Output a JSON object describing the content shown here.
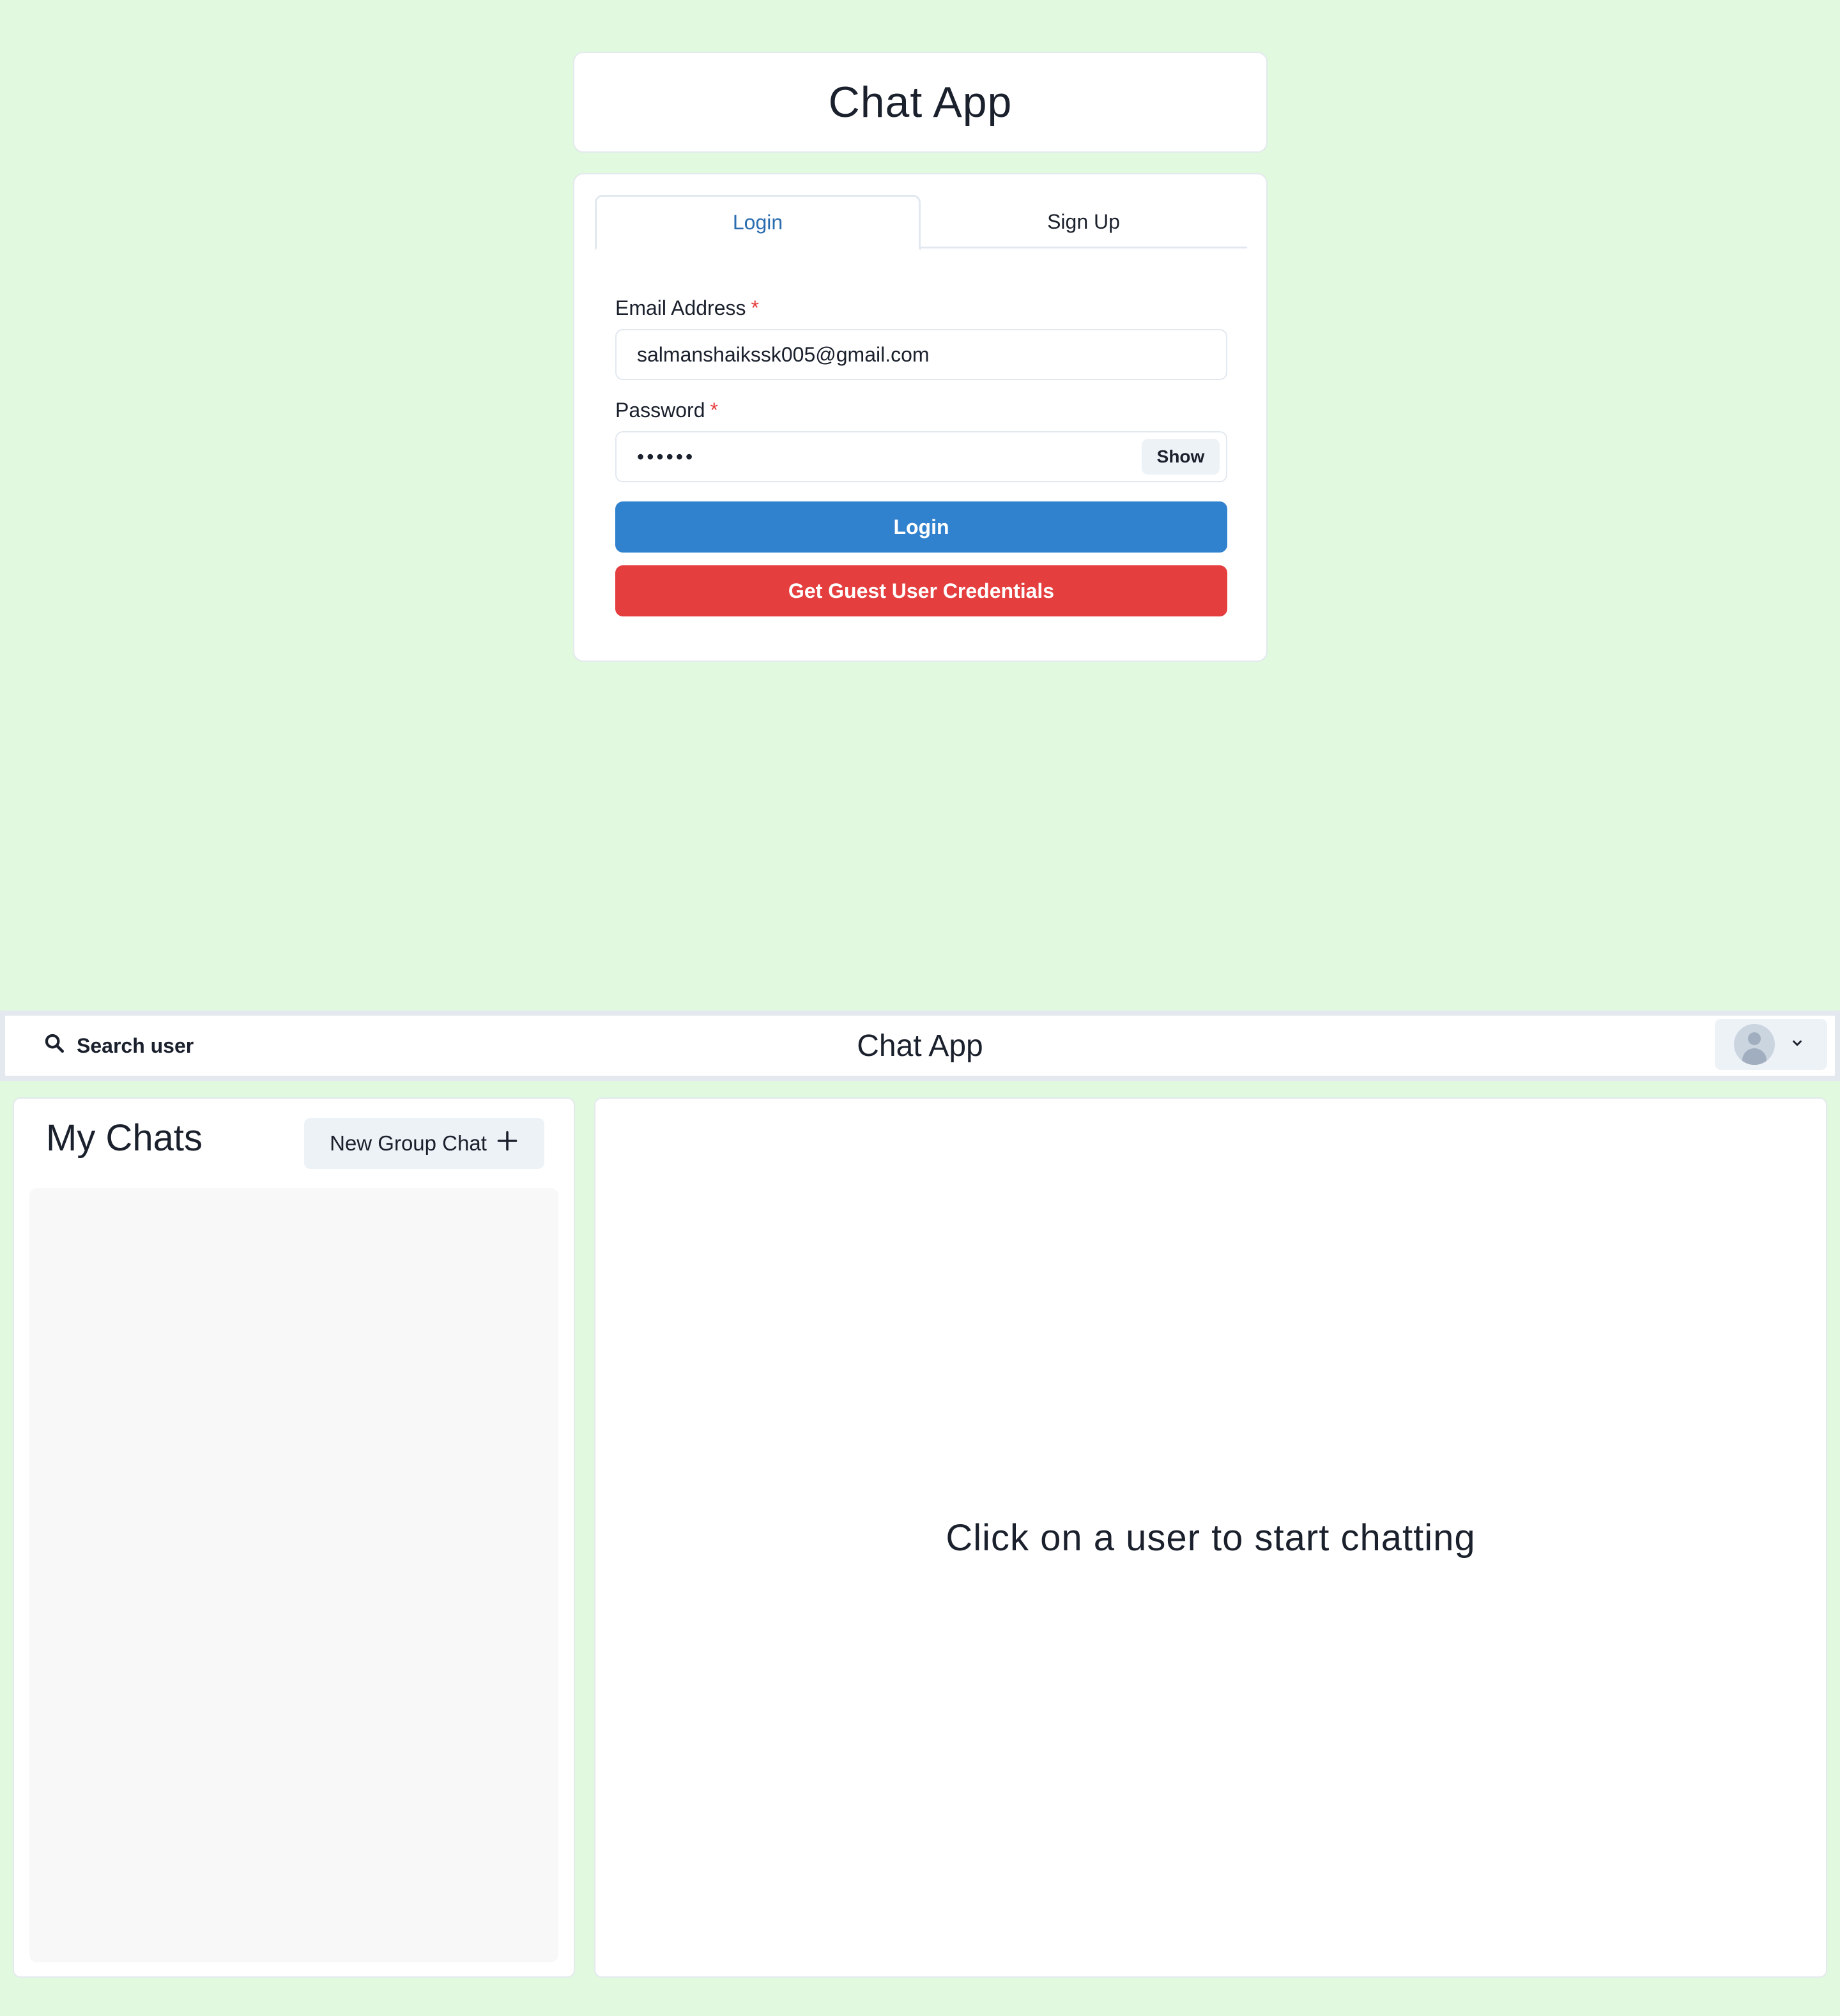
{
  "login_screen": {
    "title": "Chat App",
    "tabs": [
      {
        "label": "Login",
        "active": true
      },
      {
        "label": "Sign Up",
        "active": false
      }
    ],
    "email": {
      "label": "Email Address",
      "required_mark": "*",
      "value": "salmanshaikssk005@gmail.com"
    },
    "password": {
      "label": "Password",
      "required_mark": "*",
      "value": "••••••",
      "show_label": "Show"
    },
    "login_button": "Login",
    "guest_button": "Get Guest User Credentials"
  },
  "chat_screen": {
    "topbar": {
      "search_label": "Search user",
      "title": "Chat App"
    },
    "my_chats": {
      "title": "My Chats",
      "new_group_label": "New Group Chat"
    },
    "chatbox": {
      "placeholder": "Click on a user to start chatting"
    }
  },
  "colors": {
    "background": "#e0f9df",
    "login_button": "#3182ce",
    "guest_button": "#e53e3e",
    "active_tab": "#2b6cb0",
    "required": "#e53e3e"
  },
  "icons": [
    "search-icon",
    "avatar-icon",
    "chevron-down-icon",
    "plus-icon"
  ]
}
